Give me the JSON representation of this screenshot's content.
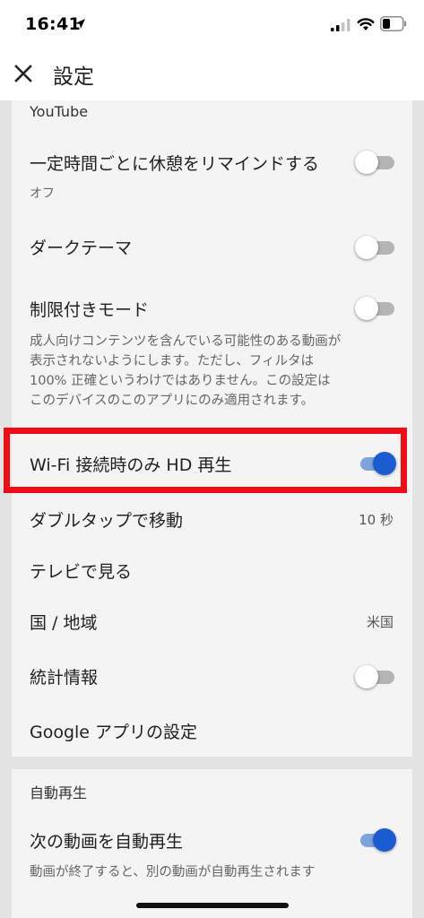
{
  "status_bar": {
    "time": "16:41"
  },
  "header": {
    "title": "設定"
  },
  "youtube_section": {
    "header": "YouTube",
    "remind_break": {
      "label": "一定時間ごとに休憩をリマインドする",
      "sub": "オフ",
      "enabled": false
    },
    "dark_theme": {
      "label": "ダークテーマ",
      "enabled": false
    },
    "restricted_mode": {
      "label": "制限付きモード",
      "description": "成人向けコンテンツを含んでいる可能性のある動画が表示されないようにします。ただし、フィルタは 100% 正確というわけではありません。この設定はこのデバイスのこのアプリにのみ適用されます。",
      "enabled": false
    },
    "hd_wifi_only": {
      "label": "Wi-Fi 接続時のみ HD 再生",
      "enabled": true
    },
    "double_tap_seek": {
      "label": "ダブルタップで移動",
      "value": "10 秒"
    },
    "watch_on_tv": {
      "label": "テレビで見る"
    },
    "location": {
      "label": "国 / 地域",
      "value": "米国"
    },
    "stats_for_nerds": {
      "label": "統計情報",
      "enabled": false
    },
    "google_app_settings": {
      "label": "Google アプリの設定"
    }
  },
  "autoplay_section": {
    "header": "自動再生",
    "autoplay_next": {
      "label": "次の動画を自動再生",
      "description": "動画が終了すると、別の動画が自動再生されます",
      "enabled": true
    }
  },
  "colors": {
    "toggle_on_thumb": "#1a5dd0",
    "toggle_on_track": "#7fa3df",
    "toggle_off_track": "#b5b5b5",
    "highlight": "#ee0d17",
    "card_bg": "#f4f4f4",
    "page_bg": "#e3e3e3"
  }
}
